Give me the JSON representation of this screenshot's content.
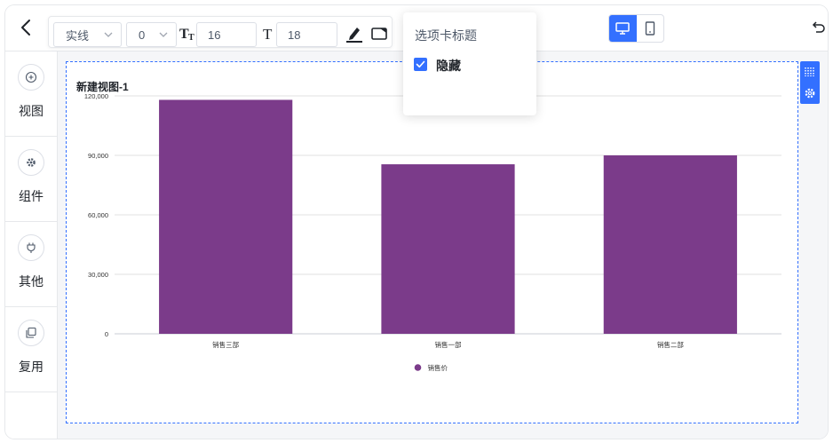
{
  "toolbar": {
    "line_style": "实线",
    "border_width": "0",
    "title_font_size": "16",
    "text_font_size": "18"
  },
  "sidebar": {
    "items": [
      {
        "label": "视图",
        "icon": "plus-circle-icon"
      },
      {
        "label": "组件",
        "icon": "gear-icon"
      },
      {
        "label": "其他",
        "icon": "plug-icon"
      },
      {
        "label": "复用",
        "icon": "copy-icon"
      }
    ]
  },
  "popover": {
    "title": "选项卡标题",
    "checkbox_label": "隐藏",
    "checked": true
  },
  "chart": {
    "title": "新建视图-1"
  },
  "colors": {
    "accent": "#3370ff",
    "bar": "#7b3b8a"
  },
  "chart_data": {
    "type": "bar",
    "title": "新建视图-1",
    "categories": [
      "销售三部",
      "销售一部",
      "销售二部"
    ],
    "series": [
      {
        "name": "销售价",
        "values": [
          118000,
          85500,
          90000
        ]
      }
    ],
    "yticks": [
      "0",
      "30,000",
      "60,000",
      "90,000",
      "120,000"
    ],
    "ylim": [
      0,
      120000
    ],
    "grid": true,
    "legend": "bottom-center"
  }
}
